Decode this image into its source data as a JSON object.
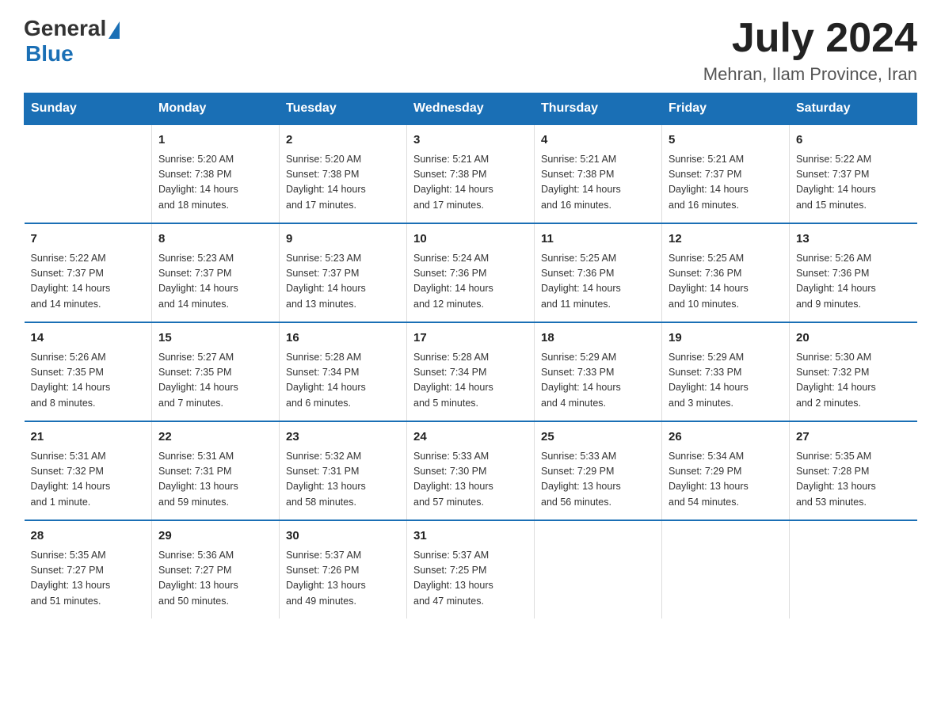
{
  "header": {
    "logo_general": "General",
    "logo_blue": "Blue",
    "title": "July 2024",
    "location": "Mehran, Ilam Province, Iran"
  },
  "days_of_week": [
    "Sunday",
    "Monday",
    "Tuesday",
    "Wednesday",
    "Thursday",
    "Friday",
    "Saturday"
  ],
  "weeks": [
    [
      {
        "day": "",
        "info": ""
      },
      {
        "day": "1",
        "info": "Sunrise: 5:20 AM\nSunset: 7:38 PM\nDaylight: 14 hours\nand 18 minutes."
      },
      {
        "day": "2",
        "info": "Sunrise: 5:20 AM\nSunset: 7:38 PM\nDaylight: 14 hours\nand 17 minutes."
      },
      {
        "day": "3",
        "info": "Sunrise: 5:21 AM\nSunset: 7:38 PM\nDaylight: 14 hours\nand 17 minutes."
      },
      {
        "day": "4",
        "info": "Sunrise: 5:21 AM\nSunset: 7:38 PM\nDaylight: 14 hours\nand 16 minutes."
      },
      {
        "day": "5",
        "info": "Sunrise: 5:21 AM\nSunset: 7:37 PM\nDaylight: 14 hours\nand 16 minutes."
      },
      {
        "day": "6",
        "info": "Sunrise: 5:22 AM\nSunset: 7:37 PM\nDaylight: 14 hours\nand 15 minutes."
      }
    ],
    [
      {
        "day": "7",
        "info": "Sunrise: 5:22 AM\nSunset: 7:37 PM\nDaylight: 14 hours\nand 14 minutes."
      },
      {
        "day": "8",
        "info": "Sunrise: 5:23 AM\nSunset: 7:37 PM\nDaylight: 14 hours\nand 14 minutes."
      },
      {
        "day": "9",
        "info": "Sunrise: 5:23 AM\nSunset: 7:37 PM\nDaylight: 14 hours\nand 13 minutes."
      },
      {
        "day": "10",
        "info": "Sunrise: 5:24 AM\nSunset: 7:36 PM\nDaylight: 14 hours\nand 12 minutes."
      },
      {
        "day": "11",
        "info": "Sunrise: 5:25 AM\nSunset: 7:36 PM\nDaylight: 14 hours\nand 11 minutes."
      },
      {
        "day": "12",
        "info": "Sunrise: 5:25 AM\nSunset: 7:36 PM\nDaylight: 14 hours\nand 10 minutes."
      },
      {
        "day": "13",
        "info": "Sunrise: 5:26 AM\nSunset: 7:36 PM\nDaylight: 14 hours\nand 9 minutes."
      }
    ],
    [
      {
        "day": "14",
        "info": "Sunrise: 5:26 AM\nSunset: 7:35 PM\nDaylight: 14 hours\nand 8 minutes."
      },
      {
        "day": "15",
        "info": "Sunrise: 5:27 AM\nSunset: 7:35 PM\nDaylight: 14 hours\nand 7 minutes."
      },
      {
        "day": "16",
        "info": "Sunrise: 5:28 AM\nSunset: 7:34 PM\nDaylight: 14 hours\nand 6 minutes."
      },
      {
        "day": "17",
        "info": "Sunrise: 5:28 AM\nSunset: 7:34 PM\nDaylight: 14 hours\nand 5 minutes."
      },
      {
        "day": "18",
        "info": "Sunrise: 5:29 AM\nSunset: 7:33 PM\nDaylight: 14 hours\nand 4 minutes."
      },
      {
        "day": "19",
        "info": "Sunrise: 5:29 AM\nSunset: 7:33 PM\nDaylight: 14 hours\nand 3 minutes."
      },
      {
        "day": "20",
        "info": "Sunrise: 5:30 AM\nSunset: 7:32 PM\nDaylight: 14 hours\nand 2 minutes."
      }
    ],
    [
      {
        "day": "21",
        "info": "Sunrise: 5:31 AM\nSunset: 7:32 PM\nDaylight: 14 hours\nand 1 minute."
      },
      {
        "day": "22",
        "info": "Sunrise: 5:31 AM\nSunset: 7:31 PM\nDaylight: 13 hours\nand 59 minutes."
      },
      {
        "day": "23",
        "info": "Sunrise: 5:32 AM\nSunset: 7:31 PM\nDaylight: 13 hours\nand 58 minutes."
      },
      {
        "day": "24",
        "info": "Sunrise: 5:33 AM\nSunset: 7:30 PM\nDaylight: 13 hours\nand 57 minutes."
      },
      {
        "day": "25",
        "info": "Sunrise: 5:33 AM\nSunset: 7:29 PM\nDaylight: 13 hours\nand 56 minutes."
      },
      {
        "day": "26",
        "info": "Sunrise: 5:34 AM\nSunset: 7:29 PM\nDaylight: 13 hours\nand 54 minutes."
      },
      {
        "day": "27",
        "info": "Sunrise: 5:35 AM\nSunset: 7:28 PM\nDaylight: 13 hours\nand 53 minutes."
      }
    ],
    [
      {
        "day": "28",
        "info": "Sunrise: 5:35 AM\nSunset: 7:27 PM\nDaylight: 13 hours\nand 51 minutes."
      },
      {
        "day": "29",
        "info": "Sunrise: 5:36 AM\nSunset: 7:27 PM\nDaylight: 13 hours\nand 50 minutes."
      },
      {
        "day": "30",
        "info": "Sunrise: 5:37 AM\nSunset: 7:26 PM\nDaylight: 13 hours\nand 49 minutes."
      },
      {
        "day": "31",
        "info": "Sunrise: 5:37 AM\nSunset: 7:25 PM\nDaylight: 13 hours\nand 47 minutes."
      },
      {
        "day": "",
        "info": ""
      },
      {
        "day": "",
        "info": ""
      },
      {
        "day": "",
        "info": ""
      }
    ]
  ]
}
